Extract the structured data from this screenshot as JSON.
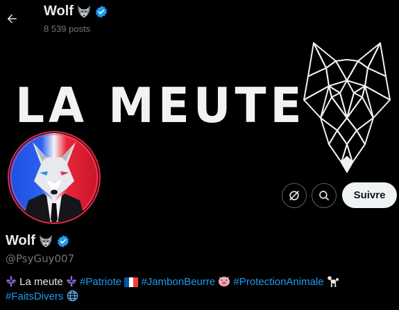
{
  "header": {
    "name": "Wolf",
    "posts_count": "8 539",
    "posts_label": "posts"
  },
  "banner": {
    "title": "LA MEUTE"
  },
  "actions": {
    "follow_label": "Suivre"
  },
  "profile": {
    "display_name": "Wolf",
    "handle": "@PsyGuy007",
    "bio": {
      "text_1": "La meute",
      "tag_1": "#Patriote",
      "tag_2": "#JambonBeurre",
      "tag_3": "#ProtectionAnimale",
      "tag_4": "#FaitsDivers"
    }
  },
  "icons": {
    "back": "arrow-left-icon",
    "verified": "verified-badge-icon",
    "wolf_emoji": "wolf-emoji-icon",
    "fleur_de_lis": "fleur-de-lis-icon",
    "flag": "france-flag-icon",
    "pig": "pig-face-icon",
    "poodle": "poodle-icon",
    "globe": "globe-icon",
    "grok": "grok-icon",
    "search": "search-icon"
  },
  "colors": {
    "accent": "#1d9bf0",
    "background": "#000000",
    "text": "#e7e9ea",
    "muted": "#71767b",
    "follow_bg": "#eff3f4"
  }
}
